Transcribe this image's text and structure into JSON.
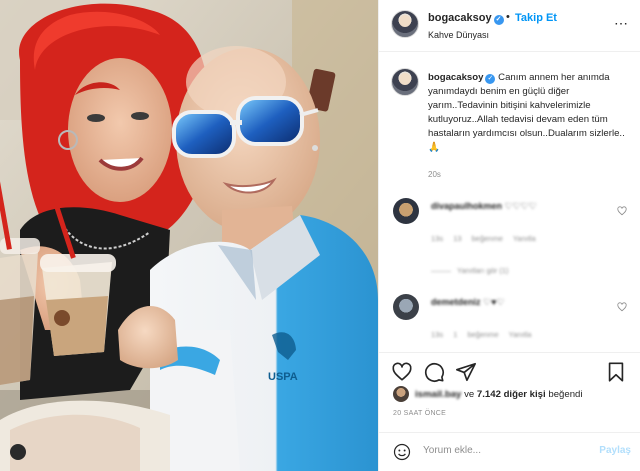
{
  "post": {
    "username": "bogacaksoy",
    "follow_separator": "•",
    "follow_label": "Takip Et",
    "location": "Kahve Dünyası",
    "more_icon": "⋯"
  },
  "caption": {
    "username": "bogacaksoy",
    "text": "Canım annem her anımda yanımdaydı benim en güçlü diğer yarım..Tedavinin bitişini kahvelerimizle kutluyoruz..Allah tedavisi devam eden tüm hastaların yardımcısı olsun..Dualarım sizlerle..",
    "emoji": "🙏",
    "time": "20s"
  },
  "comments": [
    {
      "username": "divapaulhokmen",
      "text": "♡♡♡♡",
      "time": "13s",
      "likes": "13 beğenme",
      "reply": "Yanıtla",
      "replies": "Yanıtları gör (1)"
    },
    {
      "username": "demetdeniz",
      "text": "♡♥♡",
      "time": "13s",
      "likes": "1 beğenme",
      "reply": "Yanıtla"
    }
  ],
  "likes": {
    "first_user": "ismail.bay",
    "connector": "ve",
    "others": "7.142 diğer kişi",
    "suffix": "beğendi"
  },
  "time_ago": "20 SAAT ÖNCE",
  "comment_box": {
    "placeholder": "Yorum ekle...",
    "post_label": "Paylaş"
  },
  "colors": {
    "accent": "#0095f6",
    "verified": "#3897f0",
    "post_disabled": "#b2dffc"
  }
}
